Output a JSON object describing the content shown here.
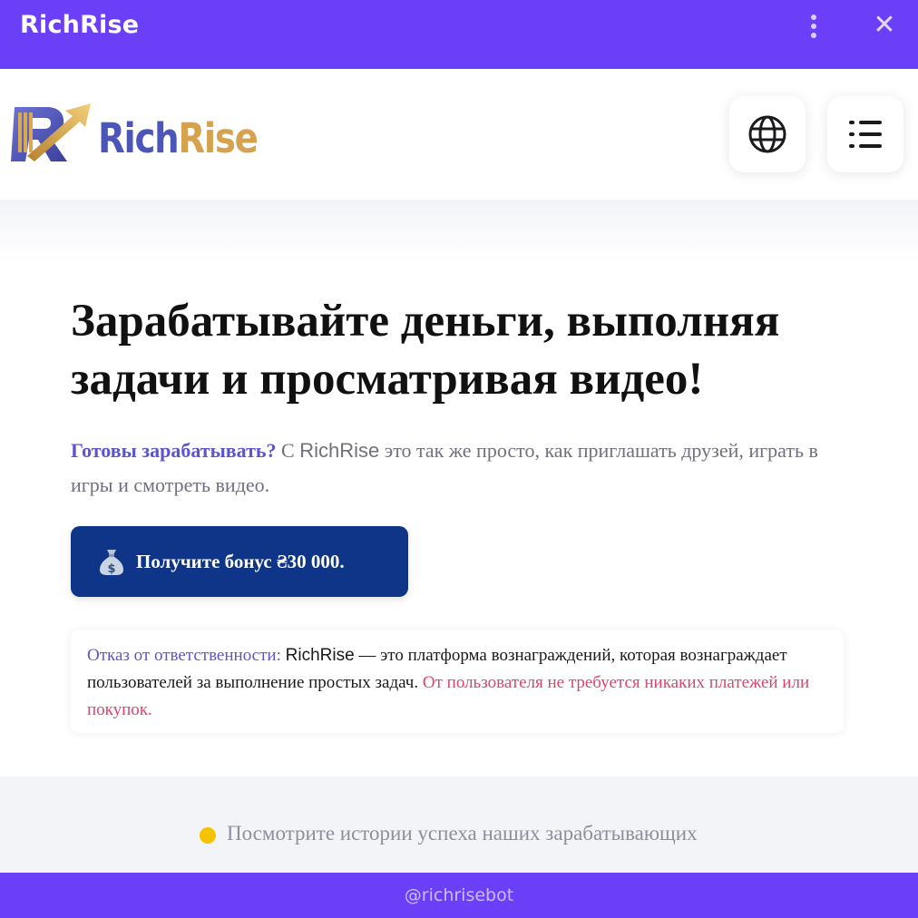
{
  "window": {
    "title": "RichRise",
    "more_icon": "kebab-vertical-icon",
    "close_icon": "close-icon",
    "close_glyph": "✕"
  },
  "header": {
    "logo_rich": "Rich",
    "logo_rise": "Rise",
    "language_icon": "globe-icon",
    "menu_icon": "menu-list-icon"
  },
  "hero": {
    "headline_line1": "Зарабатывайте деньги, выполняя",
    "headline_line2": "задачи и просматривая видео!",
    "lead_accent": "Готовы зарабатывать?",
    "lead_prefix": " С ",
    "lead_brand": "RichRise",
    "lead_rest": " это так же просто, как приглашать друзей, играть в игры и смотреть видео.",
    "cta_label": "Получите бонус ₴30 000.",
    "cta_icon": "money-bag-icon"
  },
  "disclaimer": {
    "title": "Отказ от ответственности:",
    "brand": "RichRise",
    "body": " — это платформа вознаграждений, которая вознаграждает пользователей за выполнение простых задач. ",
    "warning": "От пользователя не требуется никаких платежей или покупок."
  },
  "stories": {
    "text": "Посмотрите истории успеха наших зарабатывающих"
  },
  "footer": {
    "handle": "@richrisebot"
  },
  "colors": {
    "brand_purple": "#6a3ff7",
    "cta_blue": "#0f3588",
    "accent_violet": "#5b55d0",
    "warning_pink": "#e0436b",
    "logo_gold": "#d6a24e",
    "status_dot": "#f5c400"
  }
}
